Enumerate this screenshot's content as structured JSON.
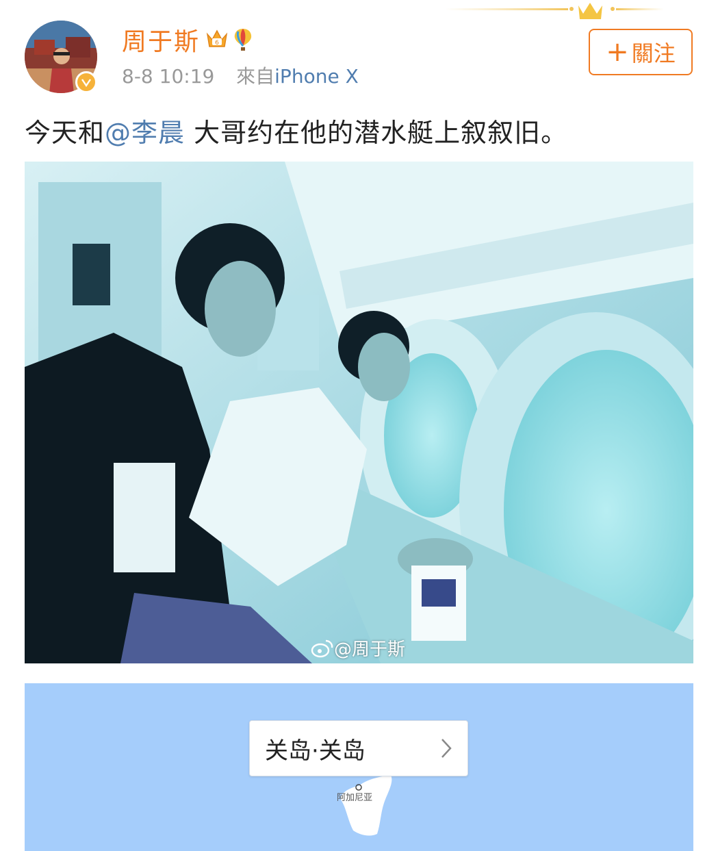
{
  "user": {
    "name": "周于斯",
    "timestamp": "8-8 10:19",
    "source_prefix": "來自",
    "device": "iPhone X"
  },
  "follow_button": {
    "label": "關注",
    "plus": "+"
  },
  "post": {
    "text_before": "今天和",
    "mention": "@李晨",
    "text_after": " 大哥约在他的潜水艇上叙叙旧。"
  },
  "photo": {
    "watermark": "@周于斯",
    "watermark_icon": "weibo-logo-icon"
  },
  "location": {
    "label": "关岛·关岛",
    "chevron_icon": "chevron-right-icon",
    "map_place": "阿加尼亚"
  },
  "colors": {
    "accent_orange": "#f07a22",
    "link_blue": "#507daf",
    "map_water": "#a5cdfb",
    "photo_tint": "#8fd0dc"
  }
}
